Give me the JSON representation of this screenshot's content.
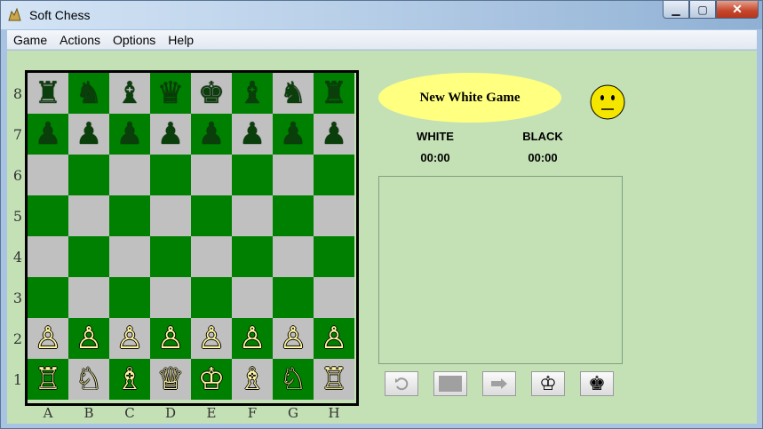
{
  "window": {
    "title": "Soft Chess"
  },
  "menu": [
    "Game",
    "Actions",
    "Options",
    "Help"
  ],
  "status": {
    "message": "New White Game"
  },
  "clocks": {
    "white_label": "WHITE",
    "white_time": "00:00",
    "black_label": "BLACK",
    "black_time": "00:00"
  },
  "board": {
    "ranks": [
      "8",
      "7",
      "6",
      "5",
      "4",
      "3",
      "2",
      "1"
    ],
    "files": [
      "A",
      "B",
      "C",
      "D",
      "E",
      "F",
      "G",
      "H"
    ],
    "rows": [
      [
        "♜",
        "♞",
        "♝",
        "♛",
        "♚",
        "♝",
        "♞",
        "♜"
      ],
      [
        "♟",
        "♟",
        "♟",
        "♟",
        "♟",
        "♟",
        "♟",
        "♟"
      ],
      [
        "",
        "",
        "",
        "",
        "",
        "",
        "",
        ""
      ],
      [
        "",
        "",
        "",
        "",
        "",
        "",
        "",
        ""
      ],
      [
        "",
        "",
        "",
        "",
        "",
        "",
        "",
        ""
      ],
      [
        "",
        "",
        "",
        "",
        "",
        "",
        "",
        ""
      ],
      [
        "♙",
        "♙",
        "♙",
        "♙",
        "♙",
        "♙",
        "♙",
        "♙"
      ],
      [
        "♖",
        "♘",
        "♗",
        "♕",
        "♔",
        "♗",
        "♘",
        "♖"
      ]
    ],
    "colors": {
      "light": "#c0c0c0",
      "dark": "#008000",
      "black_piece": "#0a3e0a",
      "white_piece": "#fff6a0"
    }
  },
  "toolbar": {
    "undo_icon": "undo-icon",
    "stop_icon": "stop-icon",
    "play_icon": "play-icon",
    "white_king": "♔",
    "black_king": "♚"
  }
}
